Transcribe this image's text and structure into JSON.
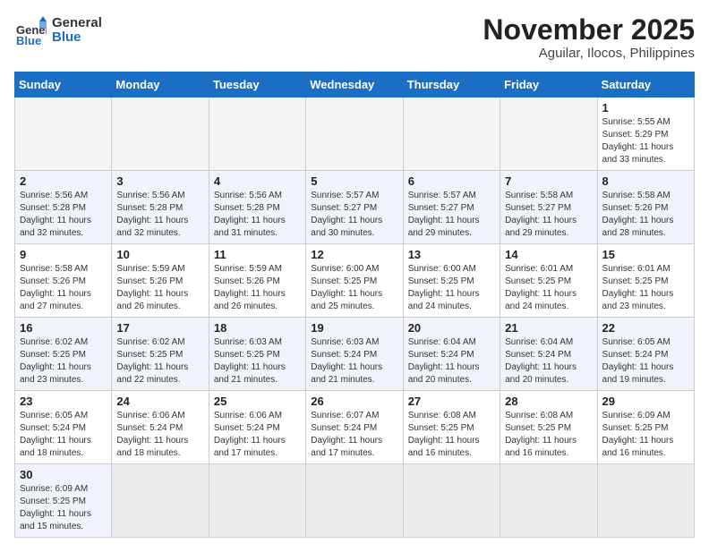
{
  "header": {
    "logo_general": "General",
    "logo_blue": "Blue",
    "month_year": "November 2025",
    "location": "Aguilar, Ilocos, Philippines"
  },
  "weekdays": [
    "Sunday",
    "Monday",
    "Tuesday",
    "Wednesday",
    "Thursday",
    "Friday",
    "Saturday"
  ],
  "weeks": [
    [
      {
        "day": "",
        "info": ""
      },
      {
        "day": "",
        "info": ""
      },
      {
        "day": "",
        "info": ""
      },
      {
        "day": "",
        "info": ""
      },
      {
        "day": "",
        "info": ""
      },
      {
        "day": "",
        "info": ""
      },
      {
        "day": "1",
        "info": "Sunrise: 5:55 AM\nSunset: 5:29 PM\nDaylight: 11 hours\nand 33 minutes."
      }
    ],
    [
      {
        "day": "2",
        "info": "Sunrise: 5:56 AM\nSunset: 5:28 PM\nDaylight: 11 hours\nand 32 minutes."
      },
      {
        "day": "3",
        "info": "Sunrise: 5:56 AM\nSunset: 5:28 PM\nDaylight: 11 hours\nand 32 minutes."
      },
      {
        "day": "4",
        "info": "Sunrise: 5:56 AM\nSunset: 5:28 PM\nDaylight: 11 hours\nand 31 minutes."
      },
      {
        "day": "5",
        "info": "Sunrise: 5:57 AM\nSunset: 5:27 PM\nDaylight: 11 hours\nand 30 minutes."
      },
      {
        "day": "6",
        "info": "Sunrise: 5:57 AM\nSunset: 5:27 PM\nDaylight: 11 hours\nand 29 minutes."
      },
      {
        "day": "7",
        "info": "Sunrise: 5:58 AM\nSunset: 5:27 PM\nDaylight: 11 hours\nand 29 minutes."
      },
      {
        "day": "8",
        "info": "Sunrise: 5:58 AM\nSunset: 5:26 PM\nDaylight: 11 hours\nand 28 minutes."
      }
    ],
    [
      {
        "day": "9",
        "info": "Sunrise: 5:58 AM\nSunset: 5:26 PM\nDaylight: 11 hours\nand 27 minutes."
      },
      {
        "day": "10",
        "info": "Sunrise: 5:59 AM\nSunset: 5:26 PM\nDaylight: 11 hours\nand 26 minutes."
      },
      {
        "day": "11",
        "info": "Sunrise: 5:59 AM\nSunset: 5:26 PM\nDaylight: 11 hours\nand 26 minutes."
      },
      {
        "day": "12",
        "info": "Sunrise: 6:00 AM\nSunset: 5:25 PM\nDaylight: 11 hours\nand 25 minutes."
      },
      {
        "day": "13",
        "info": "Sunrise: 6:00 AM\nSunset: 5:25 PM\nDaylight: 11 hours\nand 24 minutes."
      },
      {
        "day": "14",
        "info": "Sunrise: 6:01 AM\nSunset: 5:25 PM\nDaylight: 11 hours\nand 24 minutes."
      },
      {
        "day": "15",
        "info": "Sunrise: 6:01 AM\nSunset: 5:25 PM\nDaylight: 11 hours\nand 23 minutes."
      }
    ],
    [
      {
        "day": "16",
        "info": "Sunrise: 6:02 AM\nSunset: 5:25 PM\nDaylight: 11 hours\nand 23 minutes."
      },
      {
        "day": "17",
        "info": "Sunrise: 6:02 AM\nSunset: 5:25 PM\nDaylight: 11 hours\nand 22 minutes."
      },
      {
        "day": "18",
        "info": "Sunrise: 6:03 AM\nSunset: 5:25 PM\nDaylight: 11 hours\nand 21 minutes."
      },
      {
        "day": "19",
        "info": "Sunrise: 6:03 AM\nSunset: 5:24 PM\nDaylight: 11 hours\nand 21 minutes."
      },
      {
        "day": "20",
        "info": "Sunrise: 6:04 AM\nSunset: 5:24 PM\nDaylight: 11 hours\nand 20 minutes."
      },
      {
        "day": "21",
        "info": "Sunrise: 6:04 AM\nSunset: 5:24 PM\nDaylight: 11 hours\nand 20 minutes."
      },
      {
        "day": "22",
        "info": "Sunrise: 6:05 AM\nSunset: 5:24 PM\nDaylight: 11 hours\nand 19 minutes."
      }
    ],
    [
      {
        "day": "23",
        "info": "Sunrise: 6:05 AM\nSunset: 5:24 PM\nDaylight: 11 hours\nand 18 minutes."
      },
      {
        "day": "24",
        "info": "Sunrise: 6:06 AM\nSunset: 5:24 PM\nDaylight: 11 hours\nand 18 minutes."
      },
      {
        "day": "25",
        "info": "Sunrise: 6:06 AM\nSunset: 5:24 PM\nDaylight: 11 hours\nand 17 minutes."
      },
      {
        "day": "26",
        "info": "Sunrise: 6:07 AM\nSunset: 5:24 PM\nDaylight: 11 hours\nand 17 minutes."
      },
      {
        "day": "27",
        "info": "Sunrise: 6:08 AM\nSunset: 5:25 PM\nDaylight: 11 hours\nand 16 minutes."
      },
      {
        "day": "28",
        "info": "Sunrise: 6:08 AM\nSunset: 5:25 PM\nDaylight: 11 hours\nand 16 minutes."
      },
      {
        "day": "29",
        "info": "Sunrise: 6:09 AM\nSunset: 5:25 PM\nDaylight: 11 hours\nand 16 minutes."
      }
    ],
    [
      {
        "day": "30",
        "info": "Sunrise: 6:09 AM\nSunset: 5:25 PM\nDaylight: 11 hours\nand 15 minutes."
      },
      {
        "day": "",
        "info": ""
      },
      {
        "day": "",
        "info": ""
      },
      {
        "day": "",
        "info": ""
      },
      {
        "day": "",
        "info": ""
      },
      {
        "day": "",
        "info": ""
      },
      {
        "day": "",
        "info": ""
      }
    ]
  ]
}
